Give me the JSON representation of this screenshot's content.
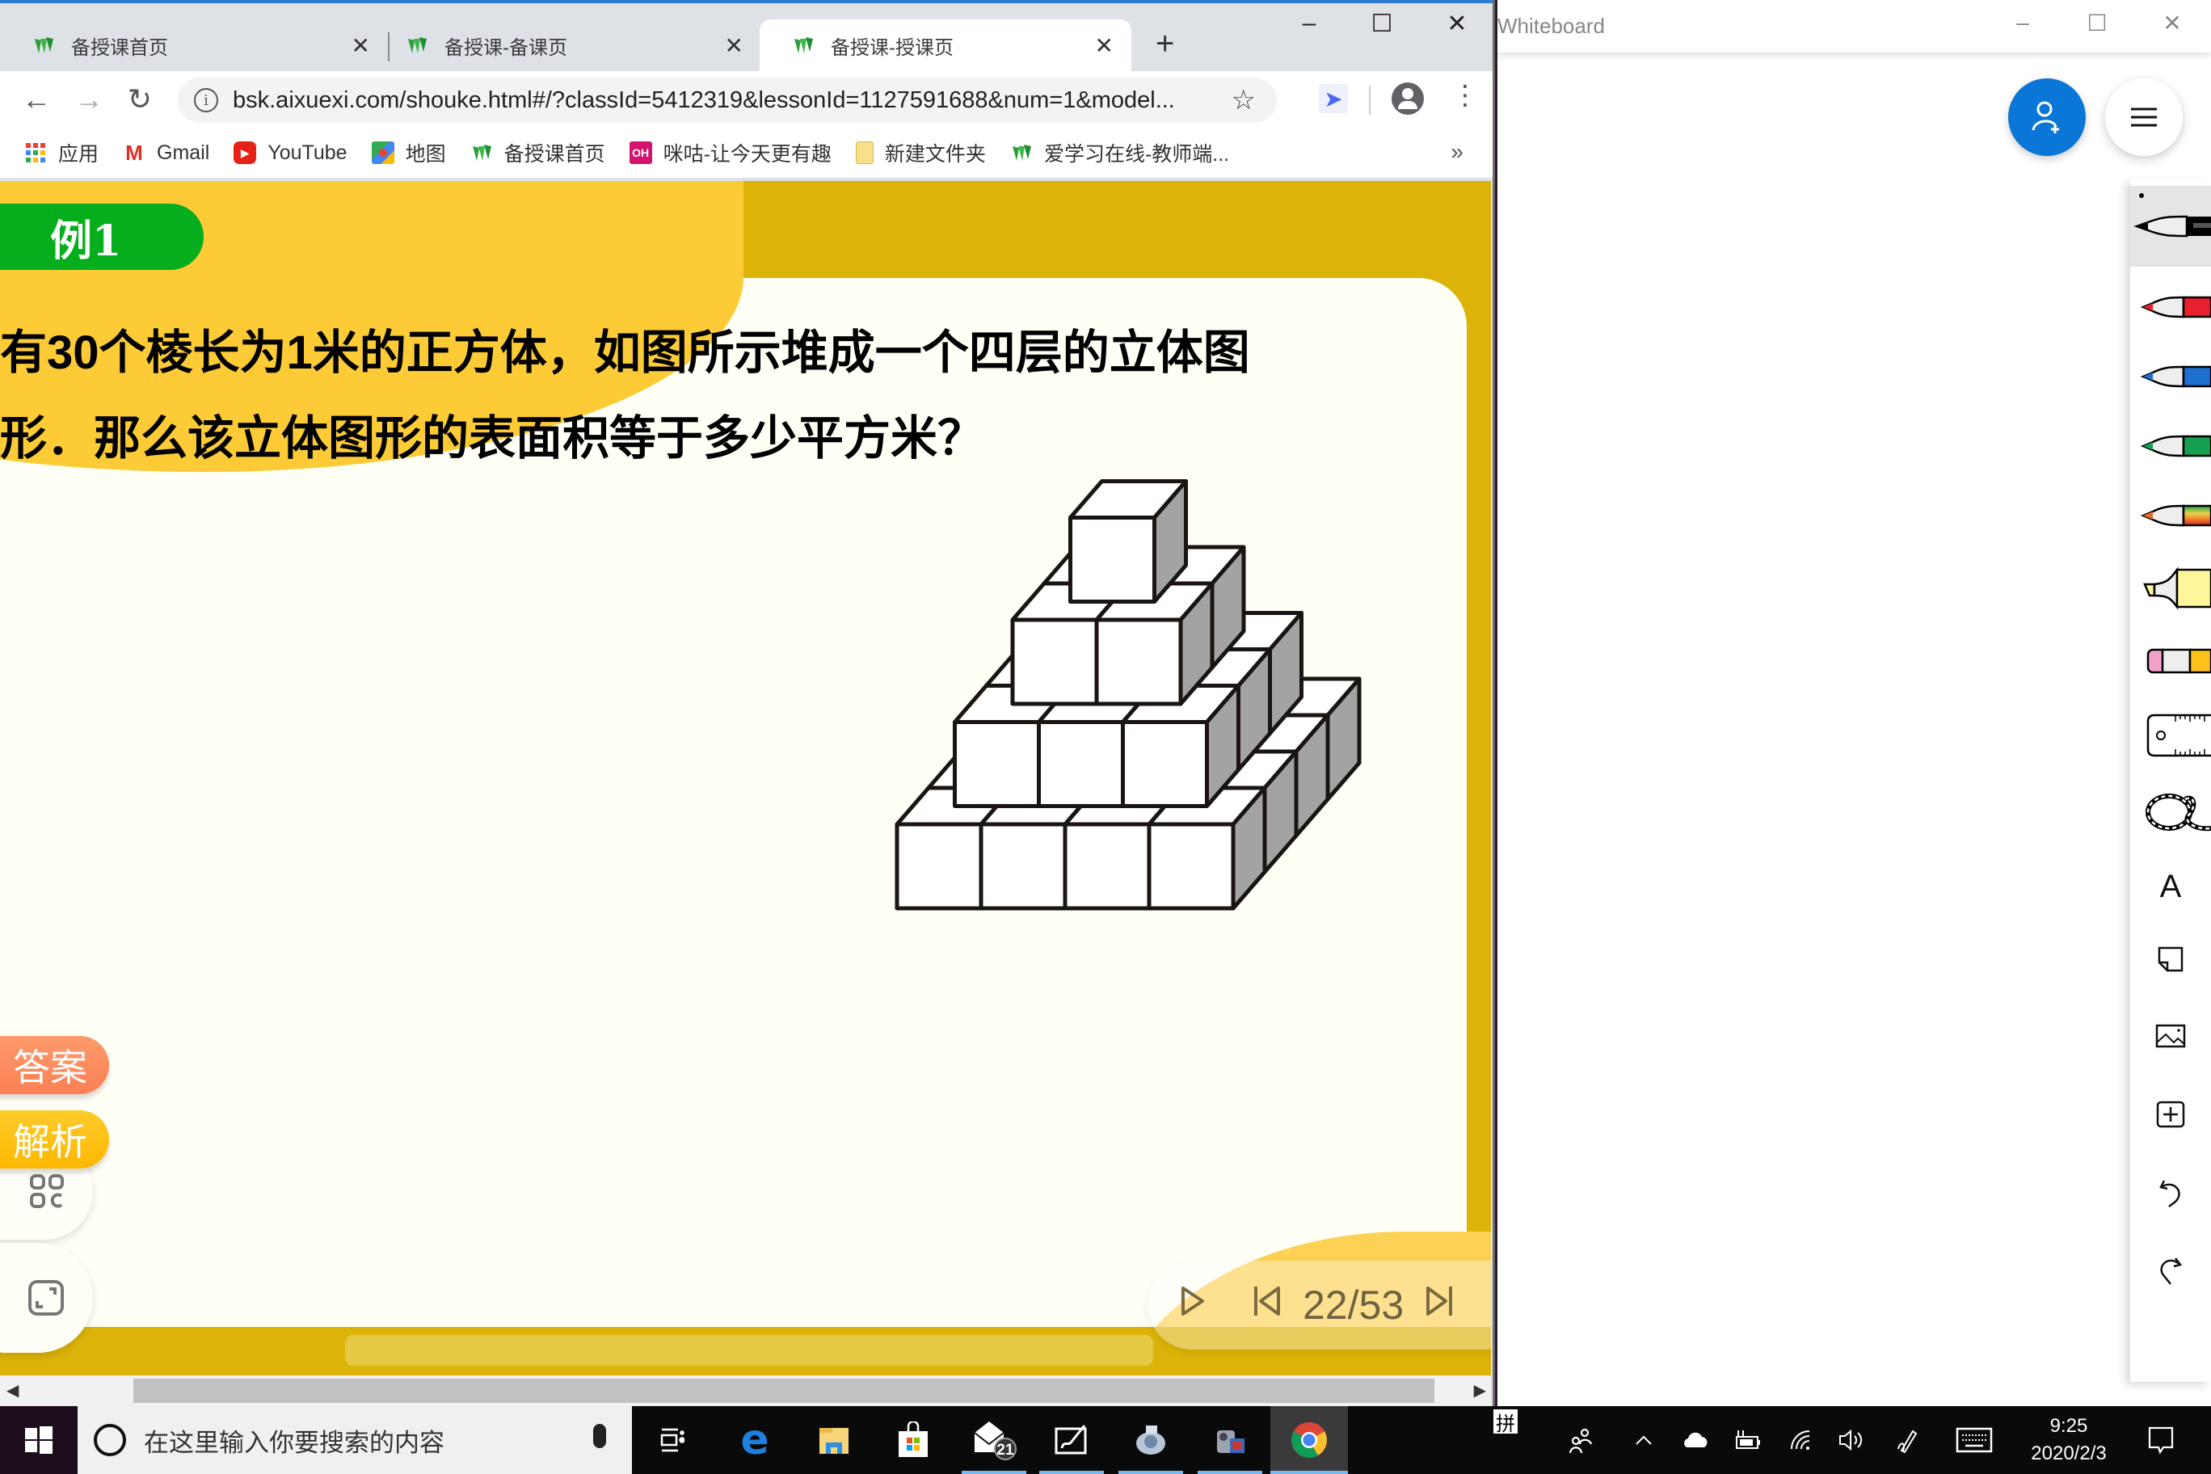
{
  "browser": {
    "tabs": [
      {
        "label": "备授课首页",
        "active": false
      },
      {
        "label": "备授课-备课页",
        "active": false
      },
      {
        "label": "备授课-授课页",
        "active": true
      }
    ],
    "new_tab_label": "+",
    "window_controls": {
      "minimize": "–",
      "maximize": "☐",
      "close": "✕"
    },
    "nav": {
      "back": "←",
      "forward": "→",
      "reload": "↻"
    },
    "address": "bsk.aixuexi.com/shouke.html#/?classId=5412319&lessonId=1127591688&num=1&model...",
    "bookmarks": [
      {
        "label": "应用",
        "icon": "apps-grid-icon"
      },
      {
        "label": "Gmail",
        "icon": "gmail-icon"
      },
      {
        "label": "YouTube",
        "icon": "youtube-icon"
      },
      {
        "label": "地图",
        "icon": "maps-icon"
      },
      {
        "label": "备授课首页",
        "icon": "aixuexi-icon"
      },
      {
        "label": "咪咕-让今天更有趣",
        "icon": "migu-icon"
      },
      {
        "label": "新建文件夹",
        "icon": "folder-icon"
      },
      {
        "label": "爱学习在线-教师端...",
        "icon": "aixuexi-icon"
      }
    ],
    "bookmarks_more": "»"
  },
  "slide": {
    "badge": "例1",
    "question_line1": "有30个棱长为1米的正方体，如图所示堆成一个四层的立体图",
    "question_line2": "形．那么该立体图形的表面积等于多少平方米？",
    "figure": {
      "description": "4-layer stepped pyramid of unit cubes",
      "layers": [
        {
          "level": 1,
          "size": "4x4",
          "cubes": 16
        },
        {
          "level": 2,
          "size": "3x3",
          "cubes": 9
        },
        {
          "level": 3,
          "size": "2x2",
          "cubes": 4
        },
        {
          "level": 4,
          "size": "1x1",
          "cubes": 1
        }
      ],
      "total_cubes": 30
    },
    "answer_button": "答案",
    "analysis_button": "解析",
    "colors": {
      "answer": "#fd8a5e",
      "analysis": "#fdbf12",
      "badge": "#06ad1c"
    },
    "pager": {
      "current": 22,
      "total": 53,
      "text": "22/53"
    }
  },
  "whiteboard": {
    "title": "Whiteboard",
    "window_controls": {
      "minimize": "–",
      "maximize": "☐",
      "close": "✕"
    },
    "tools": [
      {
        "name": "pen-black",
        "color": "#000000",
        "selected": true
      },
      {
        "name": "pen-red",
        "color": "#e8202f"
      },
      {
        "name": "pen-blue",
        "color": "#1e6fd0"
      },
      {
        "name": "pen-green",
        "color": "#14a050"
      },
      {
        "name": "pen-rainbow",
        "color": "#e46a2a"
      },
      {
        "name": "highlighter",
        "color": "#fff59a"
      },
      {
        "name": "eraser",
        "color": "#f1a0c8"
      },
      {
        "name": "ruler"
      },
      {
        "name": "lasso"
      },
      {
        "name": "text",
        "glyph": "A"
      },
      {
        "name": "sticky-note"
      },
      {
        "name": "image"
      },
      {
        "name": "insert"
      },
      {
        "name": "undo"
      },
      {
        "name": "redo"
      }
    ]
  },
  "taskbar": {
    "search_placeholder": "在这里输入你要搜索的内容",
    "mail_badge": "21",
    "ime": "拼",
    "time": "9:25",
    "date": "2020/2/3"
  }
}
